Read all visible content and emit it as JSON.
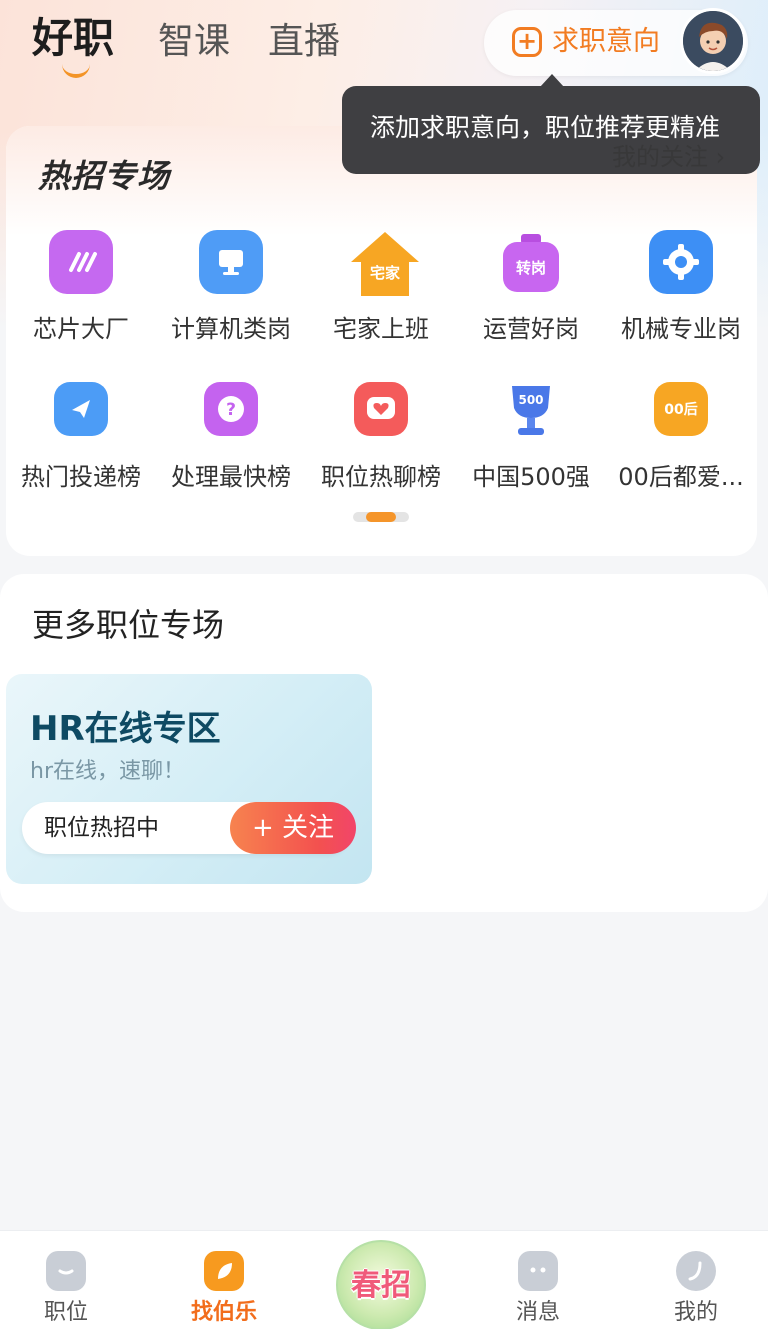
{
  "header": {
    "tabs": [
      {
        "label": "好职",
        "active": true
      },
      {
        "label": "智课",
        "active": false
      },
      {
        "label": "直播",
        "active": false
      }
    ],
    "intent_button": {
      "label": "求职意向",
      "icon": "plus-square-icon"
    },
    "avatar": "user-avatar"
  },
  "tooltip": {
    "text": "添加求职意向，职位推荐更精准"
  },
  "hot_section": {
    "title": "热招专场",
    "follow_link": "我的关注 ›",
    "row1": [
      {
        "label": "芯片大厂",
        "icon": "chip-icon",
        "color": "#c569f0"
      },
      {
        "label": "计算机类岗",
        "icon": "computer-icon",
        "color": "#4f9cf6"
      },
      {
        "label": "宅家上班",
        "icon": "house-icon",
        "icon_text": "宅家",
        "color": "#f7a623"
      },
      {
        "label": "运营好岗",
        "icon": "jar-icon",
        "icon_text": "转岗",
        "color": "#c866f0"
      },
      {
        "label": "机械专业岗",
        "icon": "gear-icon",
        "color": "#3d8ff5"
      }
    ],
    "row2": [
      {
        "label": "热门投递榜",
        "icon": "send-icon",
        "color": "#4c9cf6"
      },
      {
        "label": "处理最快榜",
        "icon": "question-icon",
        "icon_text": "?",
        "color": "#c463ef"
      },
      {
        "label": "职位热聊榜",
        "icon": "chat-heart-icon",
        "color": "#f45b5b"
      },
      {
        "label": "中国500强",
        "icon": "trophy-icon",
        "icon_text": "500",
        "color": "#4a78e8"
      },
      {
        "label": "00后都爱...",
        "icon": "badge-00-icon",
        "icon_text": "00后",
        "color": "#f7a623"
      }
    ]
  },
  "more_section": {
    "title": "更多职位专场",
    "card": {
      "title": "HR在线专区",
      "subtitle": "hr在线，速聊！",
      "pill_text": "职位热招中",
      "follow_button": "+ 关注"
    }
  },
  "bottom_nav": {
    "items": [
      {
        "label": "职位",
        "icon": "briefcase-icon",
        "active": false
      },
      {
        "label": "找伯乐",
        "icon": "leaf-card-icon",
        "active": true
      },
      {
        "label": "消息",
        "icon": "message-icon",
        "active": false
      },
      {
        "label": "我的",
        "icon": "profile-icon",
        "active": false
      }
    ],
    "center": {
      "label": "春招",
      "icon": "spring-recruit-icon"
    }
  }
}
